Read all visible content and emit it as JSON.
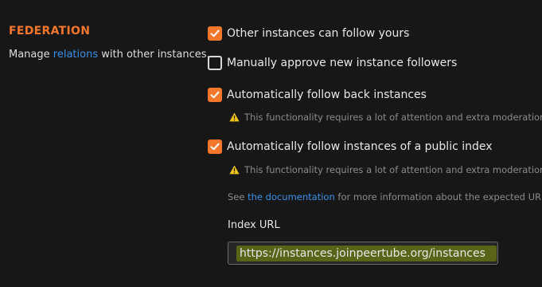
{
  "section": {
    "title": "FEDERATION",
    "description_prefix": "Manage ",
    "description_link": "relations",
    "description_suffix": " with other instances."
  },
  "options": [
    {
      "label": "Other instances can follow yours",
      "checked": true
    },
    {
      "label": "Manually approve new instance followers",
      "checked": false
    },
    {
      "label": "Automatically follow back instances",
      "checked": true
    },
    {
      "label": "Automatically follow instances of a public index",
      "checked": true
    }
  ],
  "warning_text": "This functionality requires a lot of attention and extra moderation.",
  "help": {
    "prefix": "See ",
    "link": "the documentation",
    "suffix": " for more information about the expected URL"
  },
  "index_url": {
    "label": "Index URL",
    "value": "https://instances.joinpeertube.org/instances"
  },
  "colors": {
    "accent": "#f5772b",
    "link": "#3a8fe8",
    "background": "#171717"
  }
}
